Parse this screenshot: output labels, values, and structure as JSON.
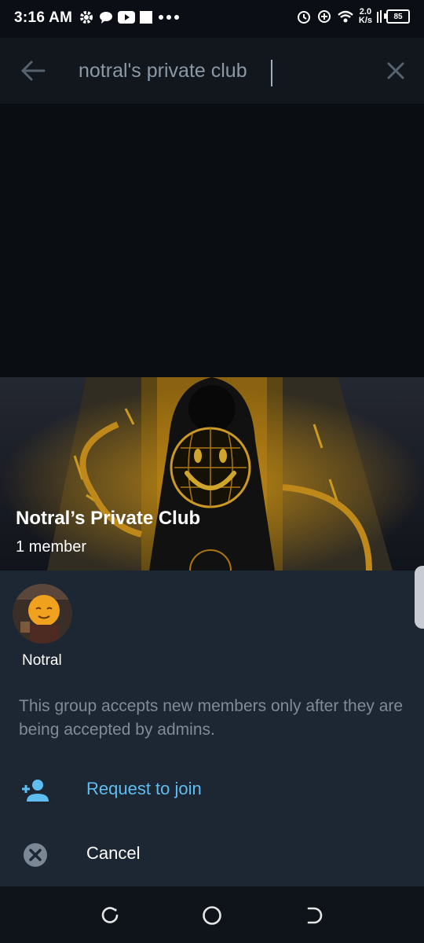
{
  "status_bar": {
    "time": "3:16 AM",
    "net_speed_value": "2.0",
    "net_speed_unit": "K/s",
    "battery": "85",
    "left_icons": [
      "gear-icon",
      "chat-bubble-icon",
      "youtube-icon",
      "square-icon",
      "more-dots-icon"
    ],
    "right_icons": [
      "alarm-icon",
      "data-saver-icon",
      "wifi-icon",
      "signal-icon",
      "battery-icon"
    ]
  },
  "search": {
    "query": "notral's private club",
    "back_icon": "arrow-left-icon",
    "clear_icon": "close-icon"
  },
  "group": {
    "title": "Notral’s Private Club",
    "member_count": "1 member"
  },
  "members": [
    {
      "name": "Notral"
    }
  ],
  "info_text": "This group accepts new members only after they are being accepted by admins.",
  "actions": {
    "request_label": "Request to join",
    "request_icon": "add-person-icon",
    "cancel_label": "Cancel",
    "cancel_icon": "cancel-circle-icon"
  },
  "colors": {
    "accent": "#5fbdf0",
    "sheet_bg": "#1d2733",
    "muted_text": "#7f8b98"
  },
  "nav_bar": {
    "icons": [
      "recents-icon",
      "home-icon",
      "back-icon"
    ]
  }
}
